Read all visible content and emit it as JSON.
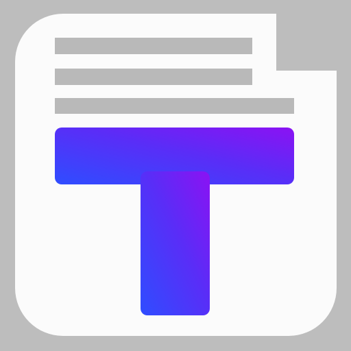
{
  "icon": {
    "name": "text-document-app-icon",
    "colors": {
      "background": "#bdbdbd",
      "page": "#fbfbfb",
      "text_lines": "#b9b9b9",
      "gradient_start": "#2f4dff",
      "gradient_mid": "#5a2df7",
      "gradient_end": "#8b12f3"
    }
  }
}
